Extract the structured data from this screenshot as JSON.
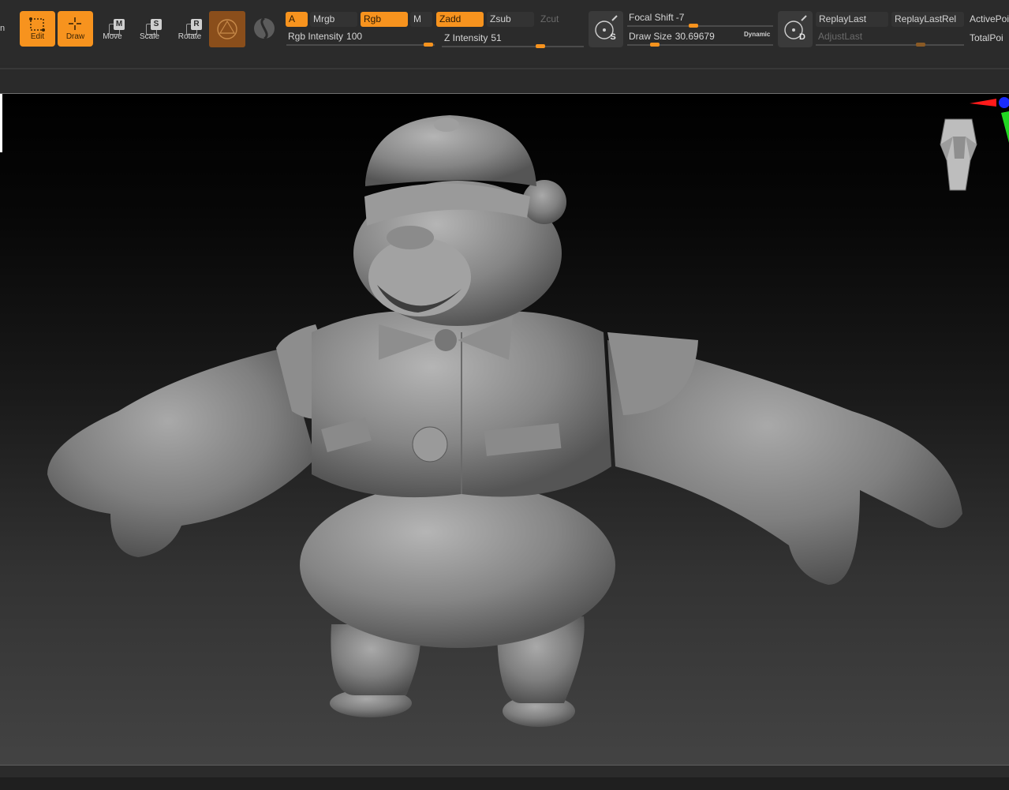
{
  "shelf": {
    "left_cut_label": "n",
    "tools": [
      {
        "label": "Edit",
        "state": "on",
        "icon": "edit-icon"
      },
      {
        "label": "Draw",
        "state": "on",
        "icon": "draw-icon"
      },
      {
        "label": "Move",
        "key": "M",
        "state": "off",
        "icon": "move-icon"
      },
      {
        "label": "Scale",
        "key": "S",
        "state": "off",
        "icon": "scale-icon"
      },
      {
        "label": "Rotate",
        "key": "R",
        "state": "off",
        "icon": "rotate-icon"
      }
    ],
    "material_icon": "material-icon",
    "texture_icon": "texture-icon",
    "a_label": "A",
    "mrgb_label": "Mrgb",
    "rgb_label": "Rgb",
    "m_label": "M",
    "zadd_label": "Zadd",
    "zsub_label": "Zsub",
    "zcut_label": "Zcut",
    "rgb_intensity": {
      "label": "Rgb Intensity",
      "value": "100"
    },
    "z_intensity": {
      "label": "Z Intensity",
      "value": "51"
    },
    "lightbox_icon": "lightbox-s-icon",
    "lightbox_key": "S",
    "focal_shift": {
      "label": "Focal Shift",
      "value": "-7"
    },
    "draw_size": {
      "label": "Draw Size",
      "value": "30.69679"
    },
    "dynamic_label": "Dynamic",
    "lightbox_d_icon": "lightbox-d-icon",
    "lightbox_d_key": "D",
    "replay_last": "ReplayLast",
    "replay_last_rel": "ReplayLastRel",
    "adjust_last": "AdjustLast",
    "active_points": "ActivePoi",
    "total_points": "TotalPoi",
    "accent_color": "#f7931e"
  },
  "viewport": {
    "subject": "bear-sculpt",
    "navcube_icon": "head-navigation-icon",
    "gizmo_icon": "axis-gizmo-icon"
  }
}
